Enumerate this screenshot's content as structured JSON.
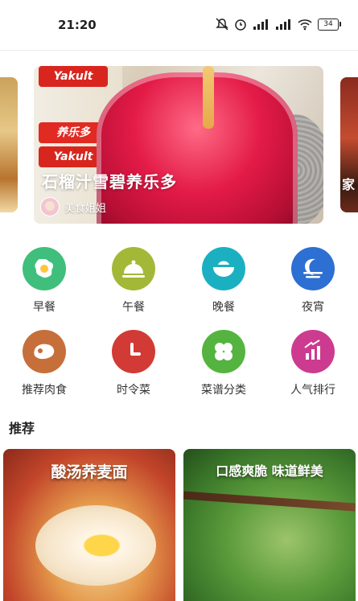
{
  "status": {
    "time": "21:20",
    "battery": "34"
  },
  "banner": {
    "title": "石榴汁雪碧养乐多",
    "author": "美食姐姐",
    "peek_right_text": "家",
    "bottle_labels": [
      "Yakult",
      "养乐多",
      "Yakult"
    ]
  },
  "categories": [
    {
      "label": "早餐",
      "icon": "egg-icon",
      "color": "#3fbf7b"
    },
    {
      "label": "午餐",
      "icon": "cloche-icon",
      "color": "#a3b837"
    },
    {
      "label": "晚餐",
      "icon": "bowl-icon",
      "color": "#1bb0c1"
    },
    {
      "label": "夜宵",
      "icon": "moon-icon",
      "color": "#2d6fd3"
    },
    {
      "label": "推荐肉食",
      "icon": "meat-icon",
      "color": "#c66f3b"
    },
    {
      "label": "时令菜",
      "icon": "clock-icon",
      "color": "#d23a35"
    },
    {
      "label": "菜谱分类",
      "icon": "clover-icon",
      "color": "#54b43f"
    },
    {
      "label": "人气排行",
      "icon": "chart-up-icon",
      "color": "#cc3b8f"
    }
  ],
  "recommend": {
    "title": "推荐",
    "cards": [
      {
        "title": "酸汤荞麦面"
      },
      {
        "title": "口感爽脆 味道鲜美"
      }
    ]
  }
}
